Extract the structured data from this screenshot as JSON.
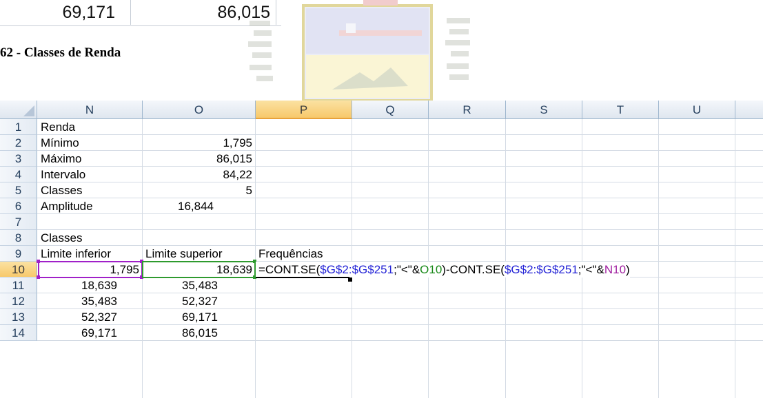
{
  "top_fragment": {
    "v1": "69,171",
    "v2": "86,015"
  },
  "heading": "62 - Classes de Renda",
  "columns": [
    "N",
    "O",
    "P",
    "Q",
    "R",
    "S",
    "T",
    "U"
  ],
  "selected_column": "P",
  "rows": [
    "1",
    "2",
    "3",
    "4",
    "5",
    "6",
    "7",
    "8",
    "9",
    "10",
    "11",
    "12",
    "13",
    "14"
  ],
  "selected_row": "10",
  "cells": {
    "N1": "Renda",
    "N2": "Mínimo",
    "O2": "1,795",
    "N3": "Máximo",
    "O3": "86,015",
    "N4": "Intervalo",
    "O4": "84,22",
    "N5": "Classes",
    "O5": "5",
    "N6": "Amplitude",
    "O6": "16,844",
    "N8": "Classes",
    "N9": "Limite inferior",
    "O9": "Limite superior",
    "P9": "Frequências",
    "N10": "1,795",
    "O10": "18,639",
    "N11": "18,639",
    "O11": "35,483",
    "N12": "35,483",
    "O12": "52,327",
    "N13": "52,327",
    "O13": "69,171",
    "N14": "69,171",
    "O14": "86,015"
  },
  "formula_parts": {
    "p1": "=CONT.SE(",
    "p2": "$G$2:$G$251",
    "p3": ";\"<\"&",
    "p4": "O10",
    "p5": ")-CONT.SE(",
    "p6": "$G$2:$G$251",
    "p7": ";\"<\"&",
    "p8": "N10",
    "p9": ")"
  },
  "colors": {
    "range_ref": "#2323d6",
    "O10_ref": "#1a8a1a",
    "N10_ref": "#a020a0",
    "header_bg": "#dfe6ef",
    "selected_header": "#f7c96b"
  }
}
